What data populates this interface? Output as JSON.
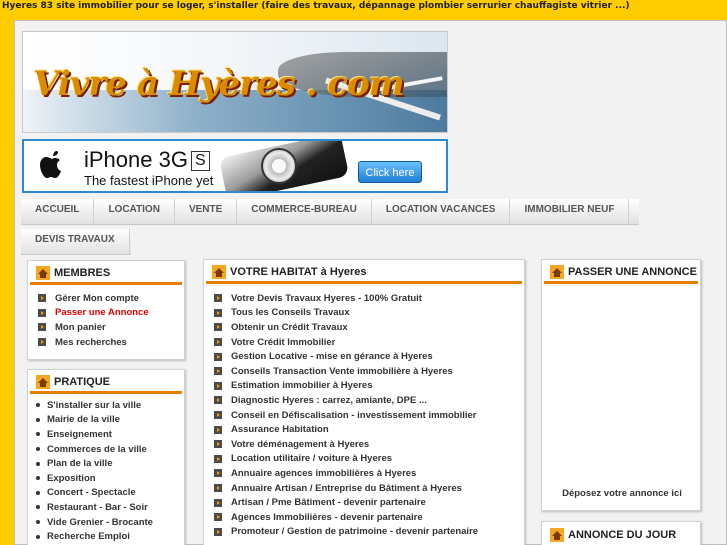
{
  "top_line": "Hyeres 83 site immobilier pour se loger, s'installer (faire des travaux, dépannage plombier serrurier chauffagiste vitrier ...)",
  "banner": {
    "logo_text": "Vivre à Hyères . com"
  },
  "ad": {
    "line1": "iPhone 3G",
    "badge": "S",
    "line2": "The fastest iPhone yet",
    "button": "Click here"
  },
  "nav": {
    "row1": [
      "ACCUEIL",
      "LOCATION",
      "VENTE",
      "COMMERCE-BUREAU",
      "LOCATION VACANCES",
      "IMMOBILIER NEUF"
    ],
    "row2": [
      "DEVIS TRAVAUX"
    ]
  },
  "membres": {
    "title": "MEMBRES",
    "items": [
      "Gérer Mon compte",
      "Passer une Annonce",
      "Mon panier",
      "Mes recherches"
    ]
  },
  "pratique": {
    "title": "PRATIQUE",
    "items": [
      "S'installer sur la ville",
      "Mairie de la ville",
      "Enseignement",
      "Commerces de la ville",
      "Plan de la ville",
      "Exposition",
      "Concert - Spectacle",
      "Restaurant - Bar - Soir",
      "Vide Grenier - Brocante",
      "Recherche Emploi"
    ]
  },
  "habitat": {
    "title": "VOTRE HABITAT à Hyeres",
    "items": [
      "Votre Devis Travaux Hyeres - 100% Gratuit",
      "Tous les Conseils Travaux",
      "Obtenir un Crédit Travaux",
      "Votre Crédit Immobilier",
      "Gestion Locative - mise en gérance à Hyeres",
      "Conseils Transaction Vente immobilière à Hyeres",
      "Estimation immobilier à Hyeres",
      "Diagnostic Hyeres : carrez, amiante, DPE ...",
      "Conseil en Défiscalisation - investissement immobilier",
      "Assurance Habitation",
      "Votre déménagement à Hyeres",
      "Location utilitaire / voiture à Hyeres",
      "Annuaire agences immobilières à Hyeres",
      "Annuaire Artisan / Entreprise du Bâtiment à Hyeres",
      "Artisan / Pme Bâtiment - devenir partenaire",
      "Agences Immobilières - devenir partenaire",
      "Promoteur / Gestion de patrimoine - devenir partenaire"
    ]
  },
  "annonce": {
    "title": "PASSER UNE ANNONCE",
    "text": "Déposez votre annonce ici"
  },
  "annonce_jour": {
    "title": "ANNONCE DU JOUR"
  },
  "colors": {
    "accent": "#e67e00",
    "background": "#ffcc00",
    "alert": "#e00000"
  }
}
